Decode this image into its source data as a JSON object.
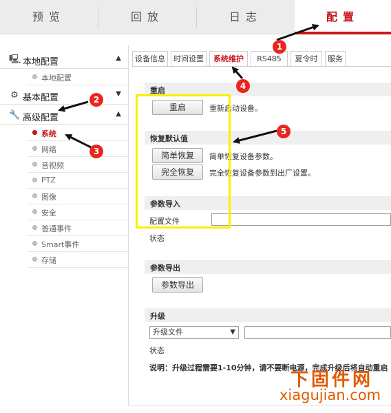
{
  "topnav": {
    "tabs": [
      {
        "label": "预览",
        "active": false
      },
      {
        "label": "回放",
        "active": false
      },
      {
        "label": "日志",
        "active": false
      },
      {
        "label": "配置",
        "active": true
      }
    ]
  },
  "sidebar": {
    "groups": [
      {
        "label": "本地配置",
        "icon": "monitor-icon",
        "arrow": "▲",
        "items": [
          {
            "label": "本地配置",
            "active": false
          }
        ]
      },
      {
        "label": "基本配置",
        "icon": "gear-icon",
        "arrow": "▼",
        "items": []
      },
      {
        "label": "高级配置",
        "icon": "wrench-icon",
        "arrow": "▲",
        "items": [
          {
            "label": "系统",
            "active": true
          },
          {
            "label": "网络",
            "active": false
          },
          {
            "label": "音视频",
            "active": false
          },
          {
            "label": "PTZ",
            "active": false
          },
          {
            "label": "图像",
            "active": false
          },
          {
            "label": "安全",
            "active": false
          },
          {
            "label": "普通事件",
            "active": false
          },
          {
            "label": "Smart事件",
            "active": false
          },
          {
            "label": "存储",
            "active": false
          }
        ]
      }
    ]
  },
  "subtabs": [
    {
      "label": "设备信息",
      "active": false
    },
    {
      "label": "时间设置",
      "active": false
    },
    {
      "label": "系统维护",
      "active": true
    },
    {
      "label": "RS485",
      "active": false
    },
    {
      "label": "夏令时",
      "active": false
    },
    {
      "label": "服务",
      "active": false
    }
  ],
  "sections": {
    "reboot": {
      "title": "重启",
      "button": "重启",
      "desc": "重新启动设备。"
    },
    "restore": {
      "title": "恢复默认值",
      "simple_button": "简单恢复",
      "simple_desc": "简单恢复设备参数。",
      "full_button": "完全恢复",
      "full_desc": "完全恢复设备参数到出厂设置。"
    },
    "import": {
      "title": "参数导入",
      "file_label": "配置文件",
      "file_value": "",
      "status_label": "状态"
    },
    "export": {
      "title": "参数导出",
      "button": "参数导出"
    },
    "upgrade": {
      "title": "升级",
      "select_value": "升级文件",
      "file_value": "",
      "status_label": "状态",
      "note": "说明：升级过程需要1-10分钟，请不要断电源，完成升级后将自动重启"
    }
  },
  "annotations": {
    "badges": [
      "1",
      "2",
      "3",
      "4",
      "5"
    ],
    "badge_color": "#e8261f",
    "box_color": "#f7f000",
    "arrow_color": "#111111"
  },
  "watermark": {
    "cn": "下固件网",
    "en": "xiagujian.com",
    "color": "#e25a00"
  },
  "accent": "#c8161d"
}
